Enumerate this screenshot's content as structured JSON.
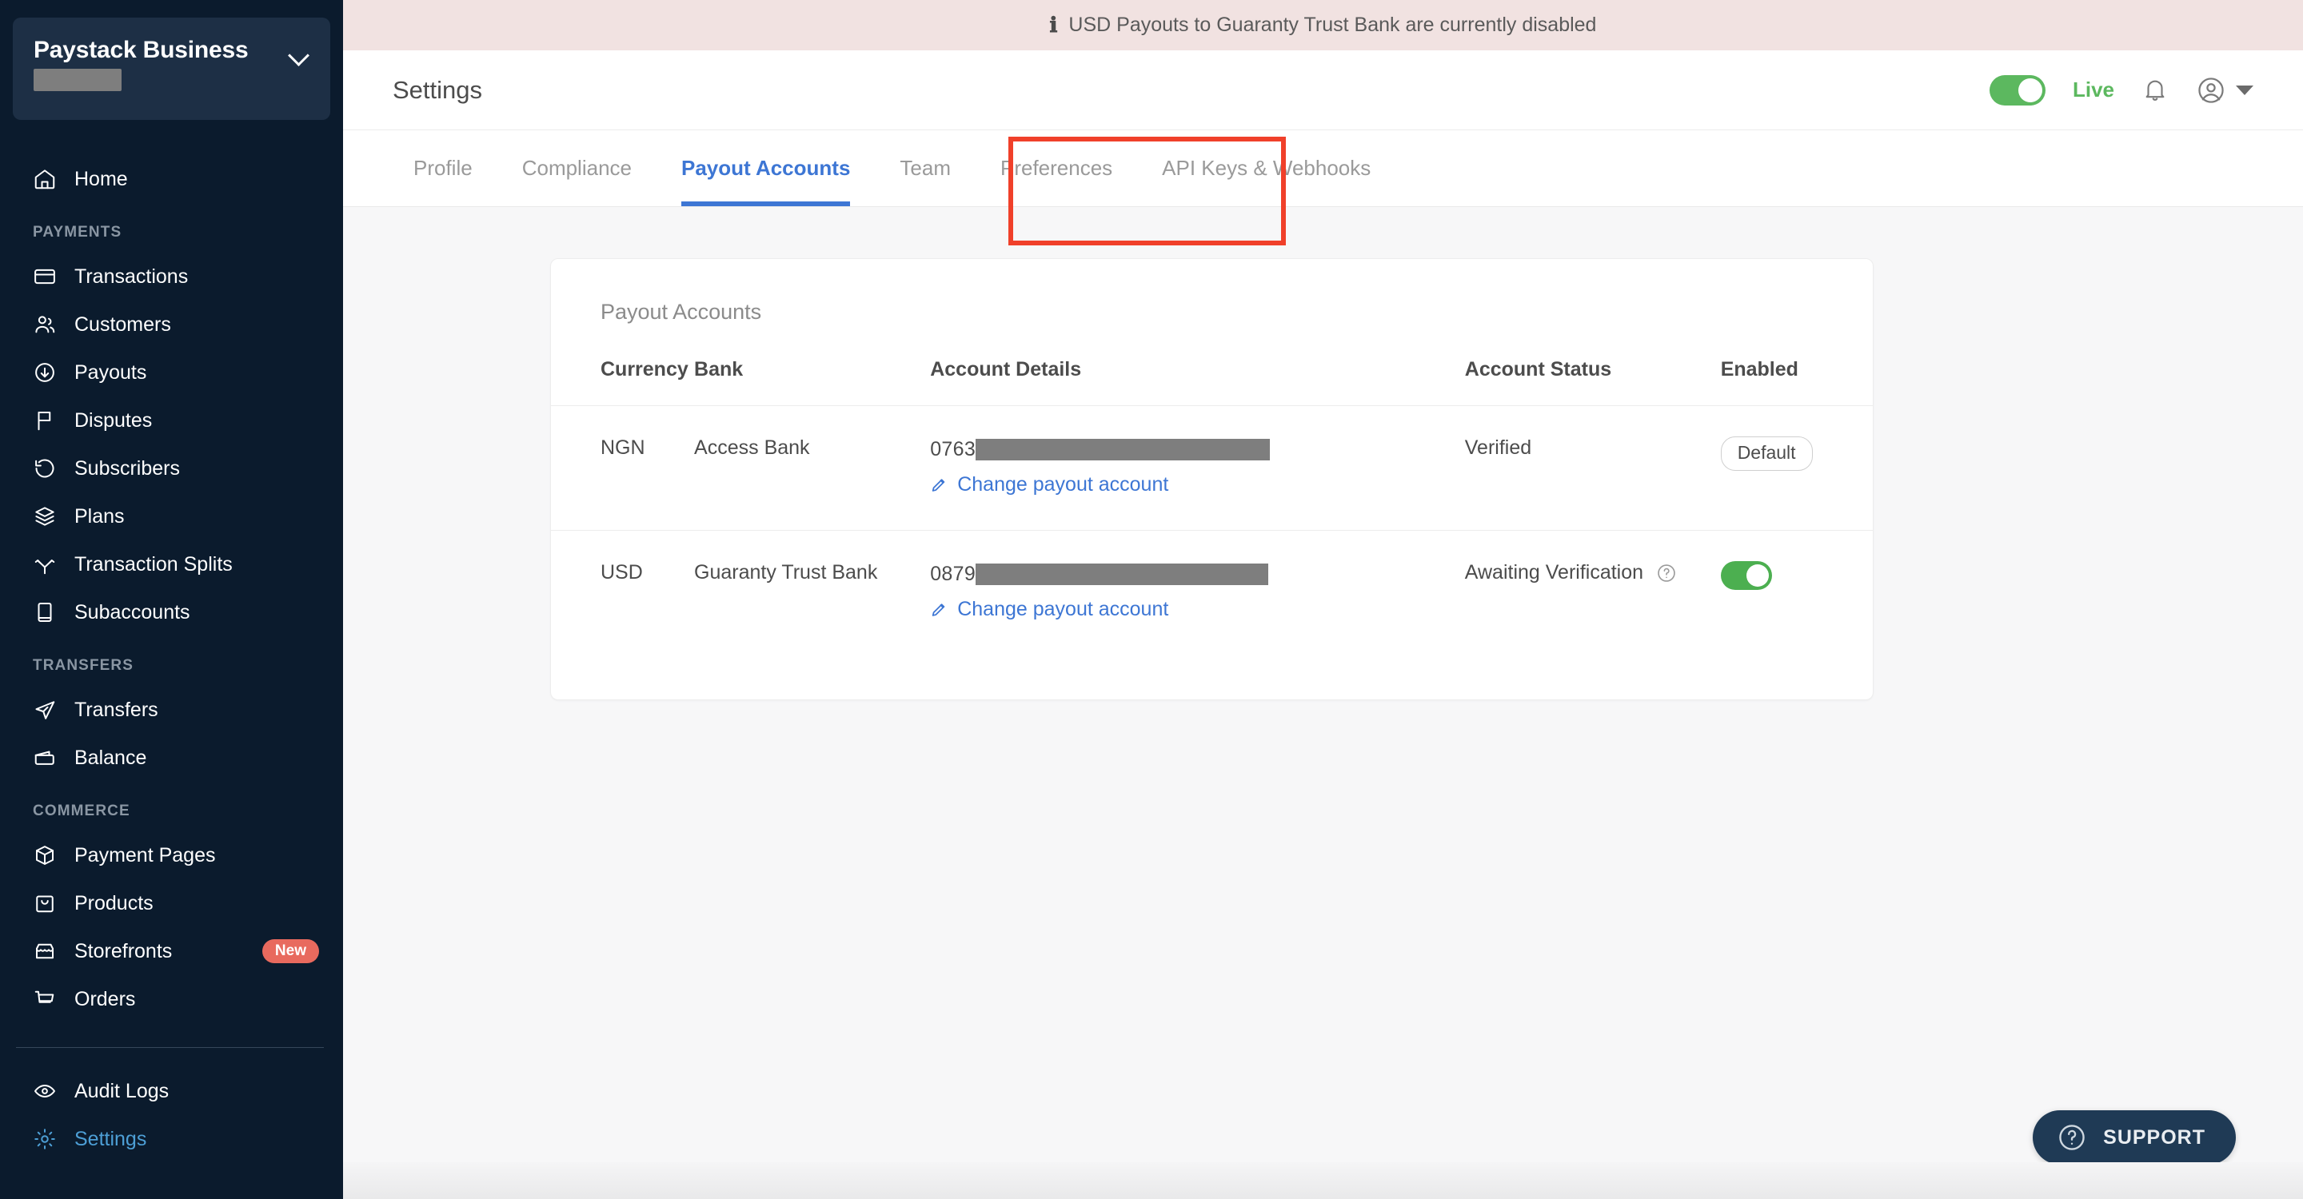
{
  "sidebar": {
    "brand": {
      "name": "Paystack Business",
      "subtitle_redacted": true,
      "chevron_icon": "chevron-down-icon"
    },
    "top_items": [
      {
        "label": "Home",
        "icon": "home-icon"
      }
    ],
    "sections": [
      {
        "title": "PAYMENTS",
        "items": [
          {
            "label": "Transactions",
            "icon": "credit-card-icon"
          },
          {
            "label": "Customers",
            "icon": "users-icon"
          },
          {
            "label": "Payouts",
            "icon": "arrow-down-circle-icon"
          },
          {
            "label": "Disputes",
            "icon": "flag-icon"
          },
          {
            "label": "Subscribers",
            "icon": "rotate-left-icon"
          },
          {
            "label": "Plans",
            "icon": "layers-icon"
          },
          {
            "label": "Transaction Splits",
            "icon": "split-icon"
          },
          {
            "label": "Subaccounts",
            "icon": "book-icon"
          }
        ]
      },
      {
        "title": "TRANSFERS",
        "items": [
          {
            "label": "Transfers",
            "icon": "send-icon"
          },
          {
            "label": "Balance",
            "icon": "wallet-icon"
          }
        ]
      },
      {
        "title": "COMMERCE",
        "items": [
          {
            "label": "Payment Pages",
            "icon": "box-icon"
          },
          {
            "label": "Products",
            "icon": "shopping-bag-icon"
          },
          {
            "label": "Storefronts",
            "icon": "storefront-icon",
            "badge": "New"
          },
          {
            "label": "Orders",
            "icon": "cart-icon"
          }
        ]
      }
    ],
    "bottom_items": [
      {
        "label": "Audit Logs",
        "icon": "eye-icon",
        "active": false
      },
      {
        "label": "Settings",
        "icon": "gear-icon",
        "active": true
      }
    ]
  },
  "banner": {
    "icon": "info-icon",
    "message": "USD Payouts to Guaranty Trust Bank are currently disabled"
  },
  "header": {
    "title": "Settings",
    "mode_toggle": {
      "label": "Live",
      "state": "on",
      "color": "#5cb85f"
    },
    "notification_icon": "bell-icon",
    "account_icon": "user-circle-icon",
    "account_caret_icon": "caret-down-icon"
  },
  "tabs": [
    {
      "label": "Profile",
      "active": false
    },
    {
      "label": "Compliance",
      "active": false
    },
    {
      "label": "Payout Accounts",
      "active": true,
      "highlighted": true
    },
    {
      "label": "Team",
      "active": false
    },
    {
      "label": "Preferences",
      "active": false
    },
    {
      "label": "API Keys & Webhooks",
      "active": false
    }
  ],
  "card": {
    "title": "Payout Accounts",
    "columns": [
      "Currency",
      "Bank",
      "Account Details",
      "Account Status",
      "Enabled"
    ],
    "rows": [
      {
        "currency": "NGN",
        "bank": "Access Bank",
        "account_prefix": "0763",
        "account_redacted_width": 368,
        "change_link": "Change payout account",
        "change_link_icon": "pencil-icon",
        "status": "Verified",
        "status_help_icon": false,
        "enabled_type": "badge",
        "enabled_badge": "Default"
      },
      {
        "currency": "USD",
        "bank": "Guaranty Trust Bank",
        "account_prefix": "0879",
        "account_redacted_width": 366,
        "change_link": "Change payout account",
        "change_link_icon": "pencil-icon",
        "status": "Awaiting Verification",
        "status_help_icon": true,
        "enabled_type": "toggle",
        "enabled_toggle_state": "on"
      }
    ]
  },
  "support": {
    "label": "SUPPORT",
    "icon": "question-circle-icon"
  },
  "colors": {
    "sidebar_bg": "#0b1b2d",
    "brand_card_bg": "#1d2f45",
    "accent_blue": "#3d76d4",
    "active_nav_blue": "#4d9fd6",
    "banner_bg": "#f1e2e1",
    "green": "#5cb85f",
    "badge_red": "#e86a5e",
    "highlight_box": "#f0402a",
    "support_bg": "#1f3a55",
    "page_bg": "#f7f7f8"
  }
}
